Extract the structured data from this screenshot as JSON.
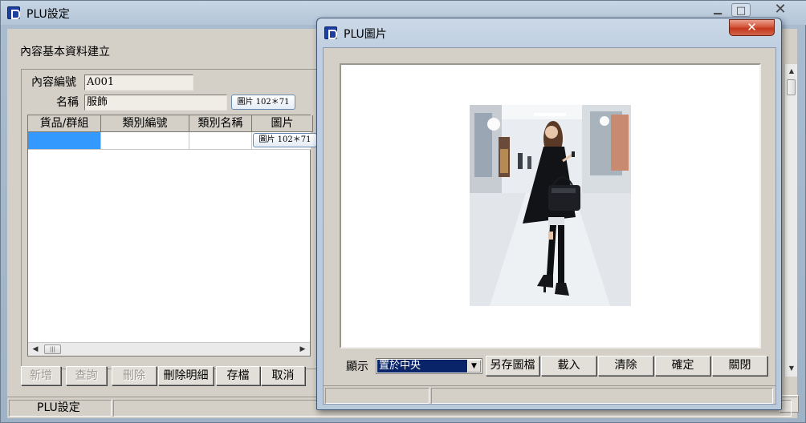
{
  "main_window": {
    "title": "PLU設定",
    "heading": "內容基本資料建立",
    "content_code_label": "內容編號",
    "content_code_value": "A001",
    "name_label": "名稱",
    "name_value": "服飾",
    "picture_button": "圖片 102＊71",
    "grid": {
      "columns": [
        "貨品/群組",
        "類別編號",
        "類別名稱",
        "圖片"
      ],
      "row_picture_button": "圖片 102＊71"
    },
    "buttons": {
      "add": "新增",
      "query": "查詢",
      "delete": "刪除",
      "delete_detail": "刪除明細",
      "save": "存檔",
      "cancel": "取消"
    },
    "status": "PLU設定"
  },
  "dialog": {
    "title": "PLU圖片",
    "close_glyph": "✕",
    "display_label": "顯示",
    "display_mode": "置於中央",
    "buttons": {
      "save_as": "另存圖檔",
      "load": "載入",
      "clear": "清除",
      "ok": "確定",
      "close": "關閉"
    }
  },
  "icons": {
    "window_minimize": "minimize-icon",
    "window_maximize": "maximize-icon",
    "window_close": "close-icon"
  },
  "colors": {
    "selection": "#3399ff",
    "combo_selection": "#0a246a",
    "dialog_close": "#c3381d"
  }
}
